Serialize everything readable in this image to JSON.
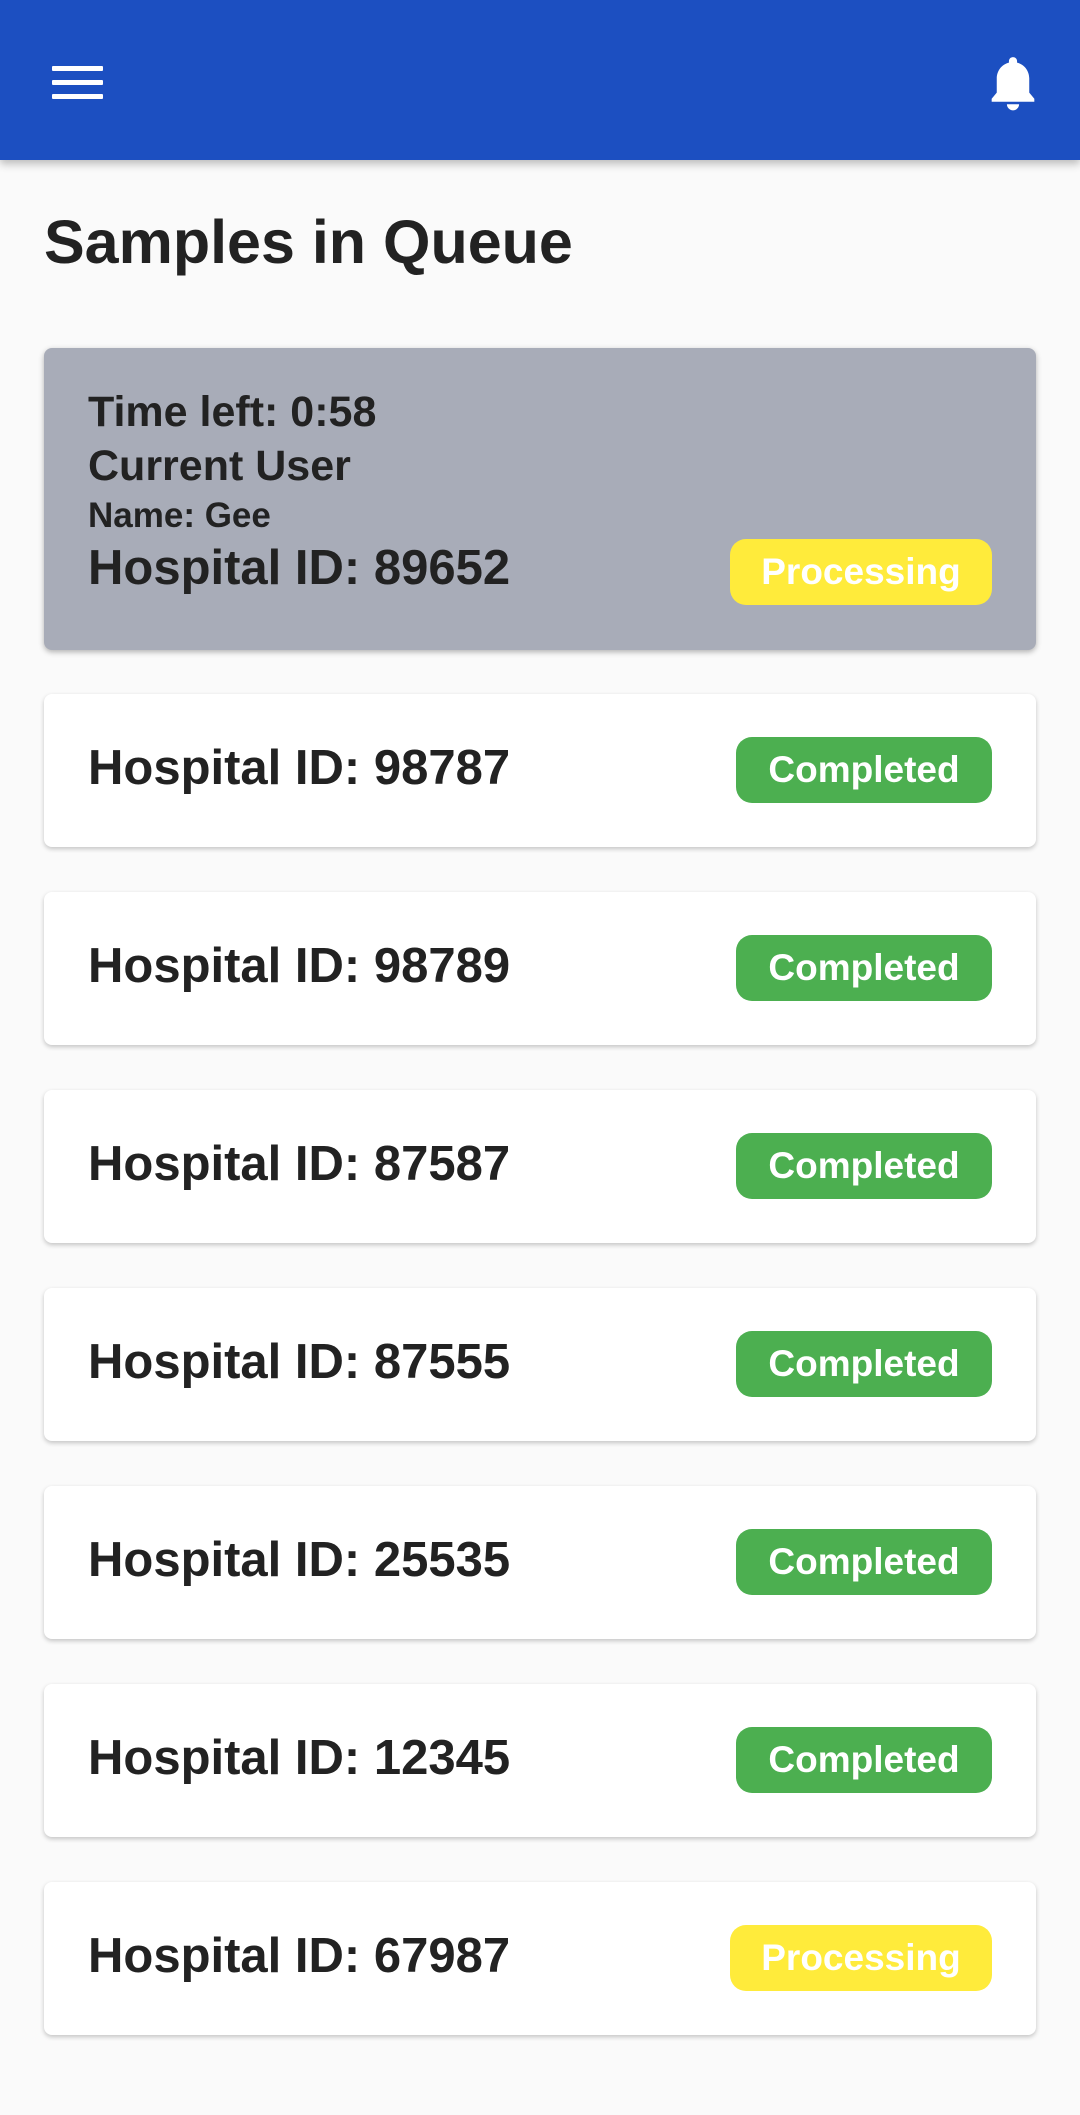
{
  "app_bar": {
    "menu_icon": "menu-icon",
    "notification_icon": "bell-icon",
    "color": "#1c4fc1"
  },
  "page": {
    "title": "Samples in Queue"
  },
  "current_sample": {
    "time_left": "Time left: 0:58",
    "user_heading": "Current User",
    "name": "Name: Gee",
    "hospital_id": "Hospital ID: 89652",
    "status": "Processing"
  },
  "queue": [
    {
      "hospital_id": "Hospital ID: 98787",
      "status": "Completed"
    },
    {
      "hospital_id": "Hospital ID: 98789",
      "status": "Completed"
    },
    {
      "hospital_id": "Hospital ID: 87587",
      "status": "Completed"
    },
    {
      "hospital_id": "Hospital ID: 87555",
      "status": "Completed"
    },
    {
      "hospital_id": "Hospital ID: 25535",
      "status": "Completed"
    },
    {
      "hospital_id": "Hospital ID: 12345",
      "status": "Completed"
    },
    {
      "hospital_id": "Hospital ID: 67987",
      "status": "Processing"
    }
  ],
  "status_colors": {
    "Completed": "#4caf50",
    "Processing": "#ffeb3b"
  }
}
